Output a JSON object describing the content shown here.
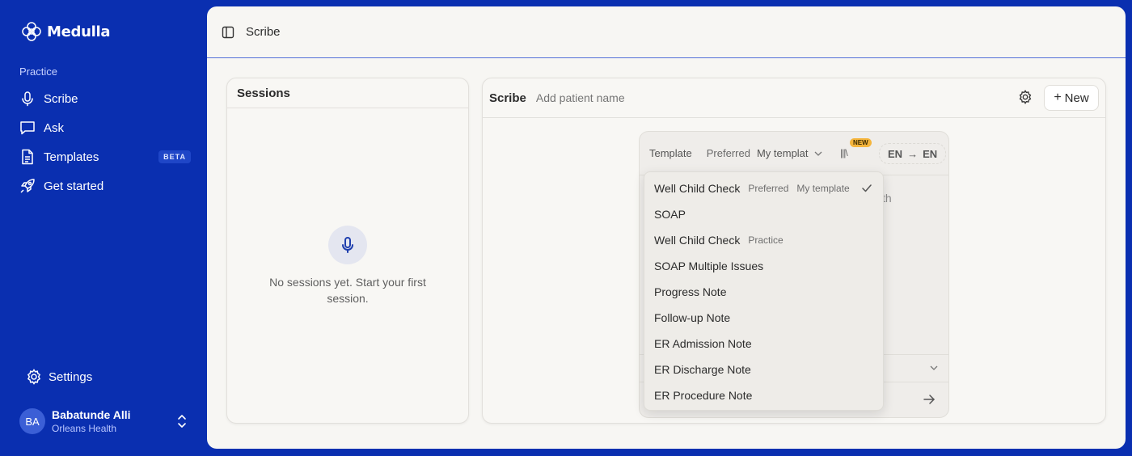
{
  "app": {
    "brand": "Medulla",
    "section_label": "Practice",
    "nav": [
      {
        "label": "Scribe",
        "icon": "mic-icon"
      },
      {
        "label": "Ask",
        "icon": "chat-icon"
      },
      {
        "label": "Templates",
        "icon": "document-icon",
        "badge": "BETA"
      },
      {
        "label": "Get started",
        "icon": "rocket-icon"
      }
    ],
    "settings_label": "Settings",
    "user": {
      "initials": "BA",
      "name": "Babatunde Alli",
      "org": "Orleans Health"
    }
  },
  "header": {
    "title": "Scribe"
  },
  "sessions": {
    "title": "Sessions",
    "empty_text": "No sessions yet. Start your first session."
  },
  "scribe": {
    "title": "Scribe",
    "patient_placeholder": "Add patient name",
    "new_label": "New",
    "template_bar": {
      "label": "Template",
      "preferred": "Preferred",
      "selected": "My templat",
      "new_tag": "NEW",
      "lang_from": "EN",
      "lang_to": "EN"
    },
    "peek_text": "th"
  },
  "template_menu": {
    "items": [
      {
        "label": "Well Child Check",
        "tags": [
          "Preferred",
          "My template"
        ],
        "selected": true
      },
      {
        "label": "SOAP",
        "tags": []
      },
      {
        "label": "Well Child Check",
        "tags": [
          "Practice"
        ]
      },
      {
        "label": "SOAP Multiple Issues",
        "tags": []
      },
      {
        "label": "Progress Note",
        "tags": []
      },
      {
        "label": "Follow-up Note",
        "tags": []
      },
      {
        "label": "ER Admission Note",
        "tags": []
      },
      {
        "label": "ER Discharge Note",
        "tags": []
      },
      {
        "label": "ER Procedure Note",
        "tags": []
      }
    ]
  },
  "colors": {
    "sidebar_bg": "#0a2fb0",
    "main_bg": "#f7f6f3",
    "accent": "#1f3fae",
    "new_tag": "#f5b53c"
  }
}
